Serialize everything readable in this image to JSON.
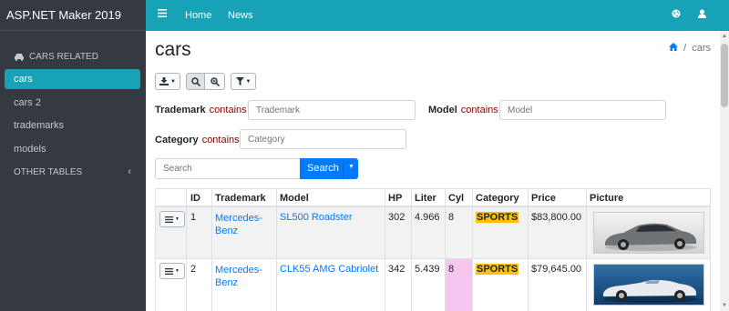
{
  "brand": "ASP.NET Maker 2019",
  "nav": {
    "menu_icon": "≡",
    "links": [
      "Home",
      "News"
    ]
  },
  "sidebar": {
    "header": "CARS RELATED",
    "items": [
      "cars",
      "cars 2",
      "trademarks",
      "models"
    ],
    "other": "OTHER TABLES"
  },
  "page": {
    "title": "cars",
    "breadcrumb": "cars"
  },
  "filters": {
    "trademark": {
      "label": "Trademark",
      "op": "contains",
      "placeholder": "Trademark"
    },
    "model": {
      "label": "Model",
      "op": "contains",
      "placeholder": "Model"
    },
    "category": {
      "label": "Category",
      "op": "contains",
      "placeholder": "Category"
    }
  },
  "search": {
    "placeholder": "Search",
    "button": "Search"
  },
  "table": {
    "columns": [
      "ID",
      "Trademark",
      "Model",
      "HP",
      "Liter",
      "Cyl",
      "Category",
      "Price",
      "Picture"
    ],
    "rows": [
      {
        "id": "1",
        "trademark_1": "Mercedes-",
        "trademark_2": "Benz",
        "model": "SL500 Roadster",
        "hp": "302",
        "liter": "4.966",
        "cyl": "8",
        "category": "SPORTS",
        "price": "$83,800.00"
      },
      {
        "id": "2",
        "trademark_1": "Mercedes-",
        "trademark_2": "Benz",
        "model": "CLK55 AMG Cabriolet",
        "hp": "342",
        "liter": "5.439",
        "cyl": "8",
        "category": "SPORTS",
        "price": "$79,645.00"
      }
    ]
  },
  "colors": {
    "accent": "#17a2b8",
    "sidebar": "#343a40",
    "primary": "#007bff",
    "badge": "#ffc107",
    "cyl_highlight": "#f7c6f0"
  }
}
